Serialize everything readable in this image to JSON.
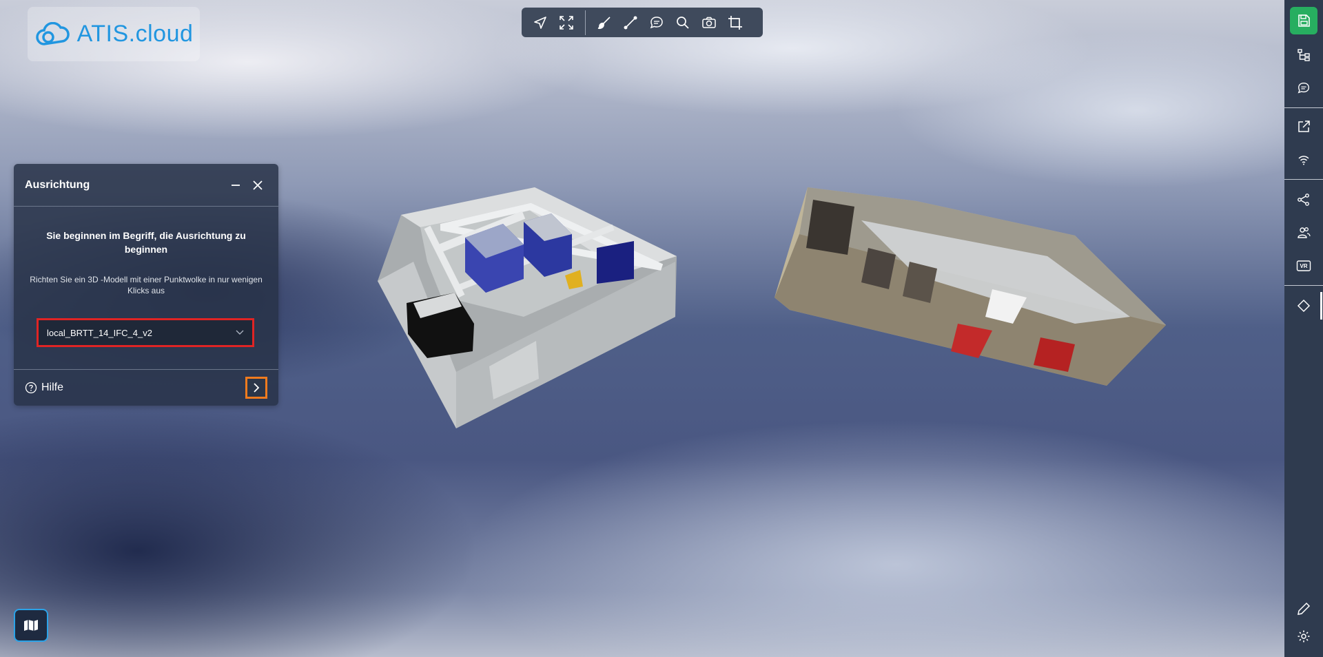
{
  "app": {
    "logo_text": "ATIS.cloud",
    "brand_color": "#2196e0"
  },
  "toolbar": {
    "icons": [
      "navigate-icon",
      "fullscreen-icon",
      "brush-icon",
      "measure-icon",
      "comment-icon",
      "search-icon",
      "camera-icon",
      "crop-icon"
    ]
  },
  "sidebar": {
    "icons": [
      "save-icon",
      "model-tree-icon",
      "comments-icon",
      "external-link-icon",
      "wifi-icon",
      "share-icon",
      "users-icon",
      "vr-icon",
      "alignment-icon",
      "edit-icon",
      "settings-icon"
    ],
    "save_color": "#27ae60",
    "vr_label": "VR"
  },
  "panel": {
    "title": "Ausrichtung",
    "heading": "Sie beginnen im Begriff, die Ausrichtung zu beginnen",
    "description": "Richten Sie ein 3D -Modell mit einer Punktwolke in nur wenigen Klicks aus",
    "select_value": "local_BRTT_14_IFC_4_v2",
    "help_label": "Hilfe"
  },
  "colors": {
    "highlight_red": "#e02424",
    "highlight_orange": "#f07b1e",
    "panel_bg": "#283248"
  }
}
